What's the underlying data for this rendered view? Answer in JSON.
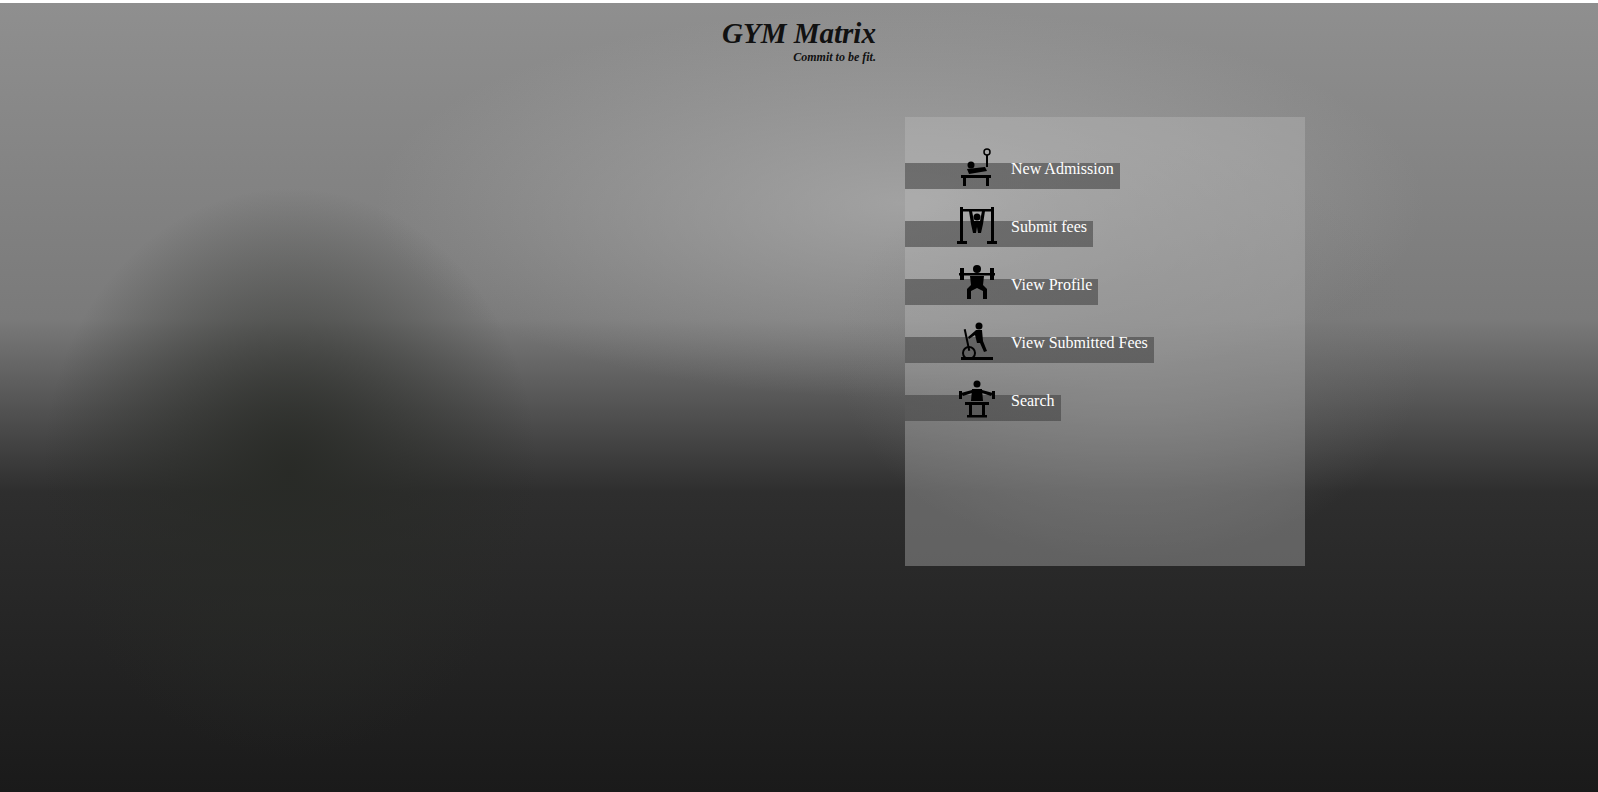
{
  "header": {
    "title": "GYM Matrix",
    "tagline": "Commit to be fit."
  },
  "menu": [
    {
      "label": "New Admission"
    },
    {
      "label": "Submit fees"
    },
    {
      "label": "View Profile"
    },
    {
      "label": "View Submitted Fees"
    },
    {
      "label": "Search"
    }
  ]
}
